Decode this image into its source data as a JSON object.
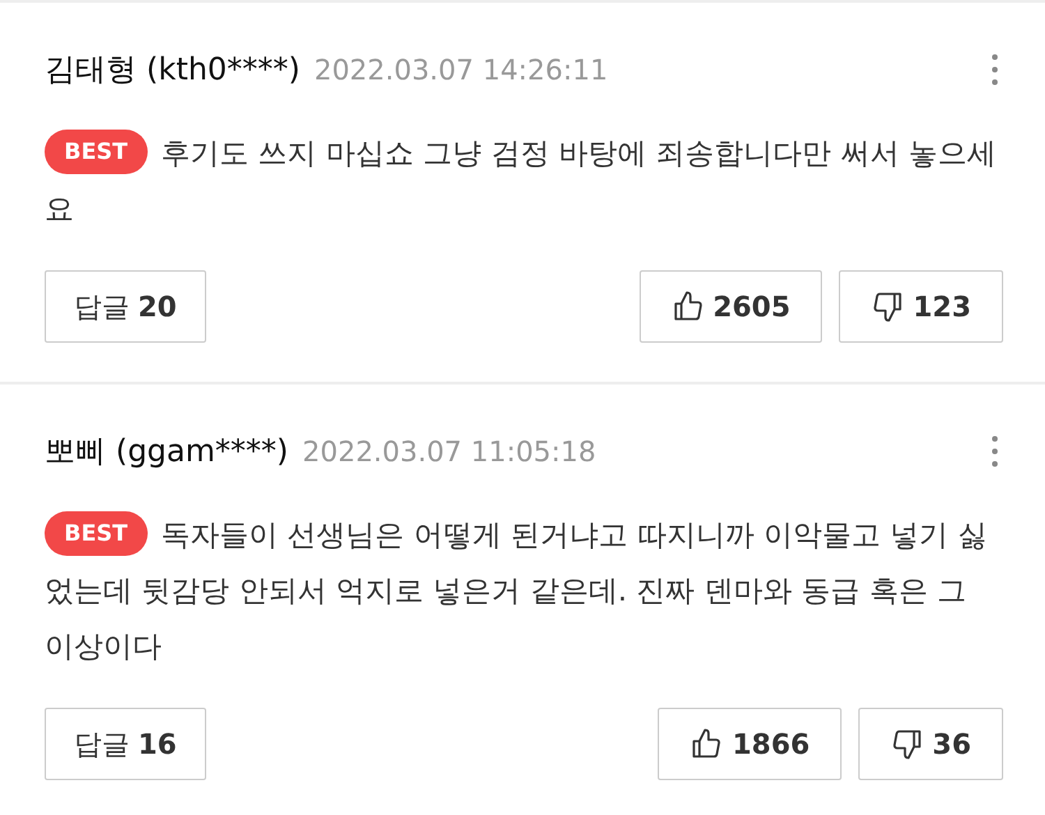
{
  "comments": [
    {
      "author": "김태형 (kth0****)",
      "time": "2022.03.07 14:26:11",
      "badge": "BEST",
      "text": "후기도 쓰지 마십쇼 그냥 검정 바탕에 죄송합니다만 써서 놓으세요",
      "reply_label": "답글",
      "reply_count": "20",
      "likes": "2605",
      "dislikes": "123"
    },
    {
      "author": "뽀삐 (ggam****)",
      "time": "2022.03.07 11:05:18",
      "badge": "BEST",
      "text": "독자들이 선생님은 어떻게 된거냐고 따지니까 이악물고 넣기 싫었는데 뒷감당 안되서 억지로 넣은거 같은데. 진짜 덴마와 동급 혹은 그 이상이다",
      "reply_label": "답글",
      "reply_count": "16",
      "likes": "1866",
      "dislikes": "36"
    }
  ]
}
